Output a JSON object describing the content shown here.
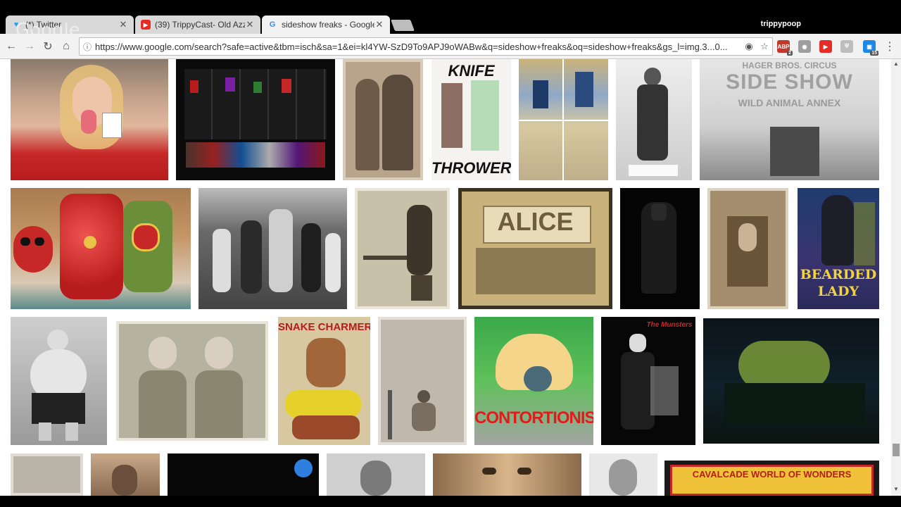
{
  "browser": {
    "watermark": "Google",
    "user": "trippypoop",
    "tabs": [
      {
        "title": "(*) Twitter",
        "icon": "twitter-icon",
        "color": "#1da1f2"
      },
      {
        "title": "(39) TrippyCast- Old Azz",
        "icon": "youtube-icon",
        "color": "#e52d27"
      },
      {
        "title": "sideshow freaks - Google",
        "icon": "google-icon",
        "color": "#4285f4"
      }
    ],
    "url": "https://www.google.com/search?safe=active&tbm=isch&sa=1&ei=kl4YW-SzD9To9APJ9oWABw&q=sideshow+freaks&oq=sideshow+freaks&gs_l=img.3...0...",
    "extensions": [
      {
        "name": "adblock-icon",
        "color": "#c0392b",
        "label": "ABP",
        "badge": "2"
      },
      {
        "name": "camera-icon",
        "color": "#9e9e9e",
        "label": "◉",
        "badge": ""
      },
      {
        "name": "youtube-ext-icon",
        "color": "#e52d27",
        "label": "▶",
        "badge": ""
      },
      {
        "name": "shield-icon",
        "color": "#bdbdbd",
        "label": "⛨",
        "badge": ""
      },
      {
        "name": "cast-icon",
        "color": "#1e88e5",
        "label": "▣",
        "badge": "15"
      }
    ]
  },
  "images": {
    "captions": {
      "knife_top": "KNIFE",
      "knife_bottom": "THROWER",
      "side_show": "SIDE SHOW",
      "circus": "HAGER BROS. CIRCUS",
      "wild_animal": "WILD ANIMAL ANNEX",
      "alice": "ALICE",
      "bearded_1": "BEARDED",
      "bearded_2": "LADY",
      "snake": "SNAKE CHARMER",
      "contortionist": "CONTORTIONIST",
      "munsters": "The Munsters",
      "cavalcade": "CAVALCADE WORLD OF WONDERS"
    }
  }
}
